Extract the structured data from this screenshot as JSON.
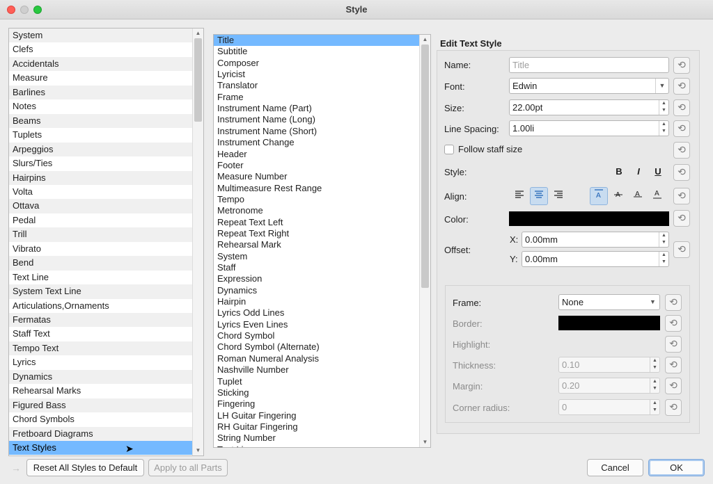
{
  "window": {
    "title": "Style"
  },
  "categories": {
    "items": [
      "System",
      "Clefs",
      "Accidentals",
      "Measure",
      "Barlines",
      "Notes",
      "Beams",
      "Tuplets",
      "Arpeggios",
      "Slurs/Ties",
      "Hairpins",
      "Volta",
      "Ottava",
      "Pedal",
      "Trill",
      "Vibrato",
      "Bend",
      "Text Line",
      "System Text Line",
      "Articulations,Ornaments",
      "Fermatas",
      "Staff Text",
      "Tempo Text",
      "Lyrics",
      "Dynamics",
      "Rehearsal Marks",
      "Figured Bass",
      "Chord Symbols",
      "Fretboard Diagrams",
      "Text Styles"
    ],
    "selected": "Text Styles"
  },
  "text_styles": {
    "items": [
      "Title",
      "Subtitle",
      "Composer",
      "Lyricist",
      "Translator",
      "Frame",
      "Instrument Name (Part)",
      "Instrument Name (Long)",
      "Instrument Name (Short)",
      "Instrument Change",
      "Header",
      "Footer",
      "Measure Number",
      "Multimeasure Rest Range",
      "Tempo",
      "Metronome",
      "Repeat Text Left",
      "Repeat Text Right",
      "Rehearsal Mark",
      "System",
      "Staff",
      "Expression",
      "Dynamics",
      "Hairpin",
      "Lyrics Odd Lines",
      "Lyrics Even Lines",
      "Chord Symbol",
      "Chord Symbol (Alternate)",
      "Roman Numeral Analysis",
      "Nashville Number",
      "Tuplet",
      "Sticking",
      "Fingering",
      "LH Guitar Fingering",
      "RH Guitar Fingering",
      "String Number",
      "Text Line"
    ],
    "selected": "Title"
  },
  "edit": {
    "heading": "Edit Text Style",
    "name_label": "Name:",
    "name_placeholder": "Title",
    "font_label": "Font:",
    "font_value": "Edwin",
    "size_label": "Size:",
    "size_value": "22.00pt",
    "line_spacing_label": "Line Spacing:",
    "line_spacing_value": "1.00li",
    "follow_staff_label": "Follow staff size",
    "follow_staff_checked": false,
    "style_label": "Style:",
    "bold_glyph": "B",
    "italic_glyph": "I",
    "underline_glyph": "U",
    "align_label": "Align:",
    "color_label": "Color:",
    "color_value": "#000000",
    "offset_label": "Offset:",
    "x_label": "X:",
    "x_value": "0.00mm",
    "y_label": "Y:",
    "y_value": "0.00mm",
    "frame_label": "Frame:",
    "frame_value": "None",
    "border_label": "Border:",
    "border_color": "#000000",
    "highlight_label": "Highlight:",
    "thickness_label": "Thickness:",
    "thickness_value": "0.10",
    "margin_label": "Margin:",
    "margin_value": "0.20",
    "corner_radius_label": "Corner radius:",
    "corner_radius_value": "0"
  },
  "footer": {
    "reset_all": "Reset All Styles to Default",
    "apply_all": "Apply to all Parts",
    "cancel": "Cancel",
    "ok": "OK"
  }
}
